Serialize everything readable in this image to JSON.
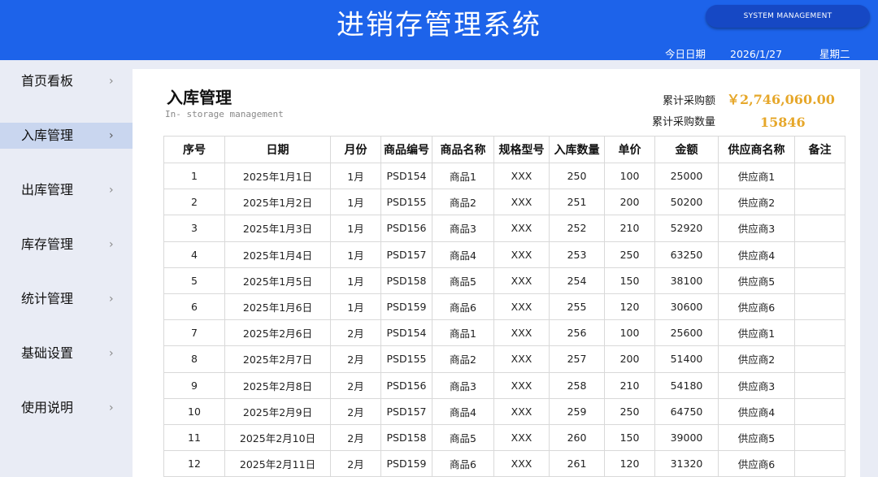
{
  "header": {
    "title": "进销存管理系统",
    "system_button": "SYSTEM MANAGEMENT",
    "date_label": "今日日期",
    "date_value": "2026/1/27",
    "weekday": "星期二"
  },
  "sidebar": {
    "items": [
      {
        "label": "首页看板",
        "active": false
      },
      {
        "label": "入库管理",
        "active": true
      },
      {
        "label": "出库管理",
        "active": false
      },
      {
        "label": "库存管理",
        "active": false
      },
      {
        "label": "统计管理",
        "active": false
      },
      {
        "label": "基础设置",
        "active": false
      },
      {
        "label": "使用说明",
        "active": false
      }
    ],
    "chevron": "›"
  },
  "main": {
    "title": "入库管理",
    "subtitle": "In- storage management",
    "stats": {
      "total_amount_label": "累计采购额",
      "total_amount_value": "￥2,746,060.00",
      "total_qty_label": "累计采购数量",
      "total_qty_value": "15846"
    },
    "table": {
      "columns": [
        "序号",
        "日期",
        "月份",
        "商品编号",
        "商品名称",
        "规格型号",
        "入库数量",
        "单价",
        "金额",
        "供应商名称",
        "备注"
      ],
      "rows": [
        [
          "1",
          "2025年1月1日",
          "1月",
          "PSD154",
          "商品1",
          "XXX",
          "250",
          "100",
          "25000",
          "供应商1",
          ""
        ],
        [
          "2",
          "2025年1月2日",
          "1月",
          "PSD155",
          "商品2",
          "XXX",
          "251",
          "200",
          "50200",
          "供应商2",
          ""
        ],
        [
          "3",
          "2025年1月3日",
          "1月",
          "PSD156",
          "商品3",
          "XXX",
          "252",
          "210",
          "52920",
          "供应商3",
          ""
        ],
        [
          "4",
          "2025年1月4日",
          "1月",
          "PSD157",
          "商品4",
          "XXX",
          "253",
          "250",
          "63250",
          "供应商4",
          ""
        ],
        [
          "5",
          "2025年1月5日",
          "1月",
          "PSD158",
          "商品5",
          "XXX",
          "254",
          "150",
          "38100",
          "供应商5",
          ""
        ],
        [
          "6",
          "2025年1月6日",
          "1月",
          "PSD159",
          "商品6",
          "XXX",
          "255",
          "120",
          "30600",
          "供应商6",
          ""
        ],
        [
          "7",
          "2025年2月6日",
          "2月",
          "PSD154",
          "商品1",
          "XXX",
          "256",
          "100",
          "25600",
          "供应商1",
          ""
        ],
        [
          "8",
          "2025年2月7日",
          "2月",
          "PSD155",
          "商品2",
          "XXX",
          "257",
          "200",
          "51400",
          "供应商2",
          ""
        ],
        [
          "9",
          "2025年2月8日",
          "2月",
          "PSD156",
          "商品3",
          "XXX",
          "258",
          "210",
          "54180",
          "供应商3",
          ""
        ],
        [
          "10",
          "2025年2月9日",
          "2月",
          "PSD157",
          "商品4",
          "XXX",
          "259",
          "250",
          "64750",
          "供应商4",
          ""
        ],
        [
          "11",
          "2025年2月10日",
          "2月",
          "PSD158",
          "商品5",
          "XXX",
          "260",
          "150",
          "39000",
          "供应商5",
          ""
        ],
        [
          "12",
          "2025年2月11日",
          "2月",
          "PSD159",
          "商品6",
          "XXX",
          "261",
          "120",
          "31320",
          "供应商6",
          ""
        ]
      ]
    }
  },
  "colors": {
    "header_bg": "#1d63ea",
    "button_bg": "#1648c4",
    "stat_value": "#e6a72a",
    "active_nav_bg": "#c9d6ef",
    "page_bg": "#e9ecf5"
  }
}
